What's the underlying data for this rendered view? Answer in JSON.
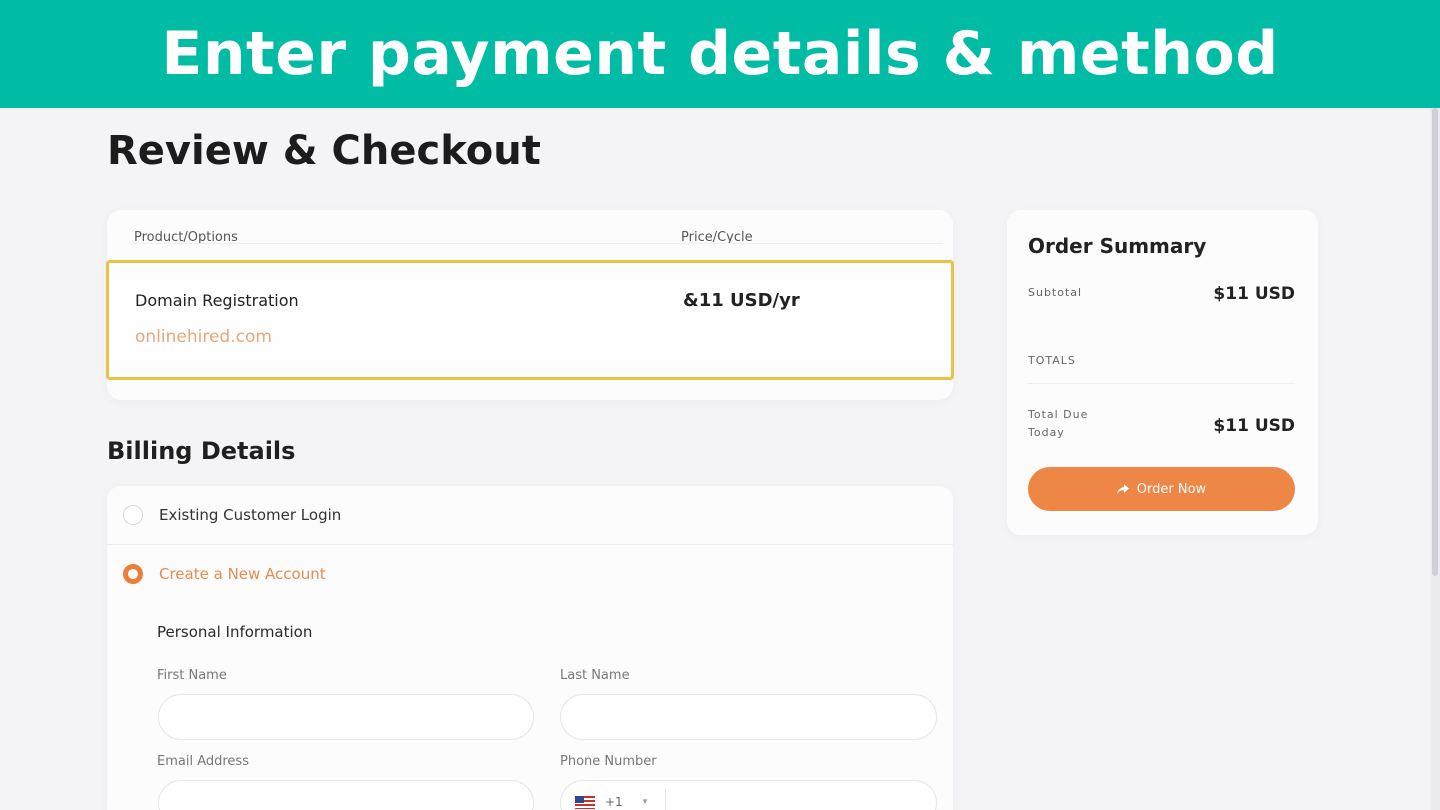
{
  "banner": {
    "text": "Enter payment details & method"
  },
  "page": {
    "title": "Review & Checkout"
  },
  "products": {
    "col_product": "Product/Options",
    "col_price": "Price/Cycle",
    "item": {
      "name": "Domain Registration",
      "domain": "onlinehired.com",
      "price": "&11 USD/yr"
    }
  },
  "billing": {
    "title": "Billing Details",
    "existing_login": "Existing Customer Login",
    "create_account": "Create a New Account",
    "personal_info": "Personal Information",
    "first_name_label": "First Name",
    "last_name_label": "Last Name",
    "email_label": "Email Address",
    "phone_label": "Phone Number",
    "phone_code": "+1",
    "selected_option": "create_account"
  },
  "summary": {
    "title": "Order Summary",
    "subtotal_label": "Subtotal",
    "subtotal_value": "$11 USD",
    "totals_label": "TOTALS",
    "total_due_label": "Total Due Today",
    "total_due_value": "$11 USD",
    "order_button": "Order Now"
  },
  "colors": {
    "banner": "#00bca4",
    "accent": "#ee8646",
    "highlight_border": "#e9c24a"
  },
  "icons": {
    "order_button_icon": "share-arrow-icon",
    "flag_icon": "us-flag-icon",
    "dropdown_icon": "chevron-down-icon"
  }
}
